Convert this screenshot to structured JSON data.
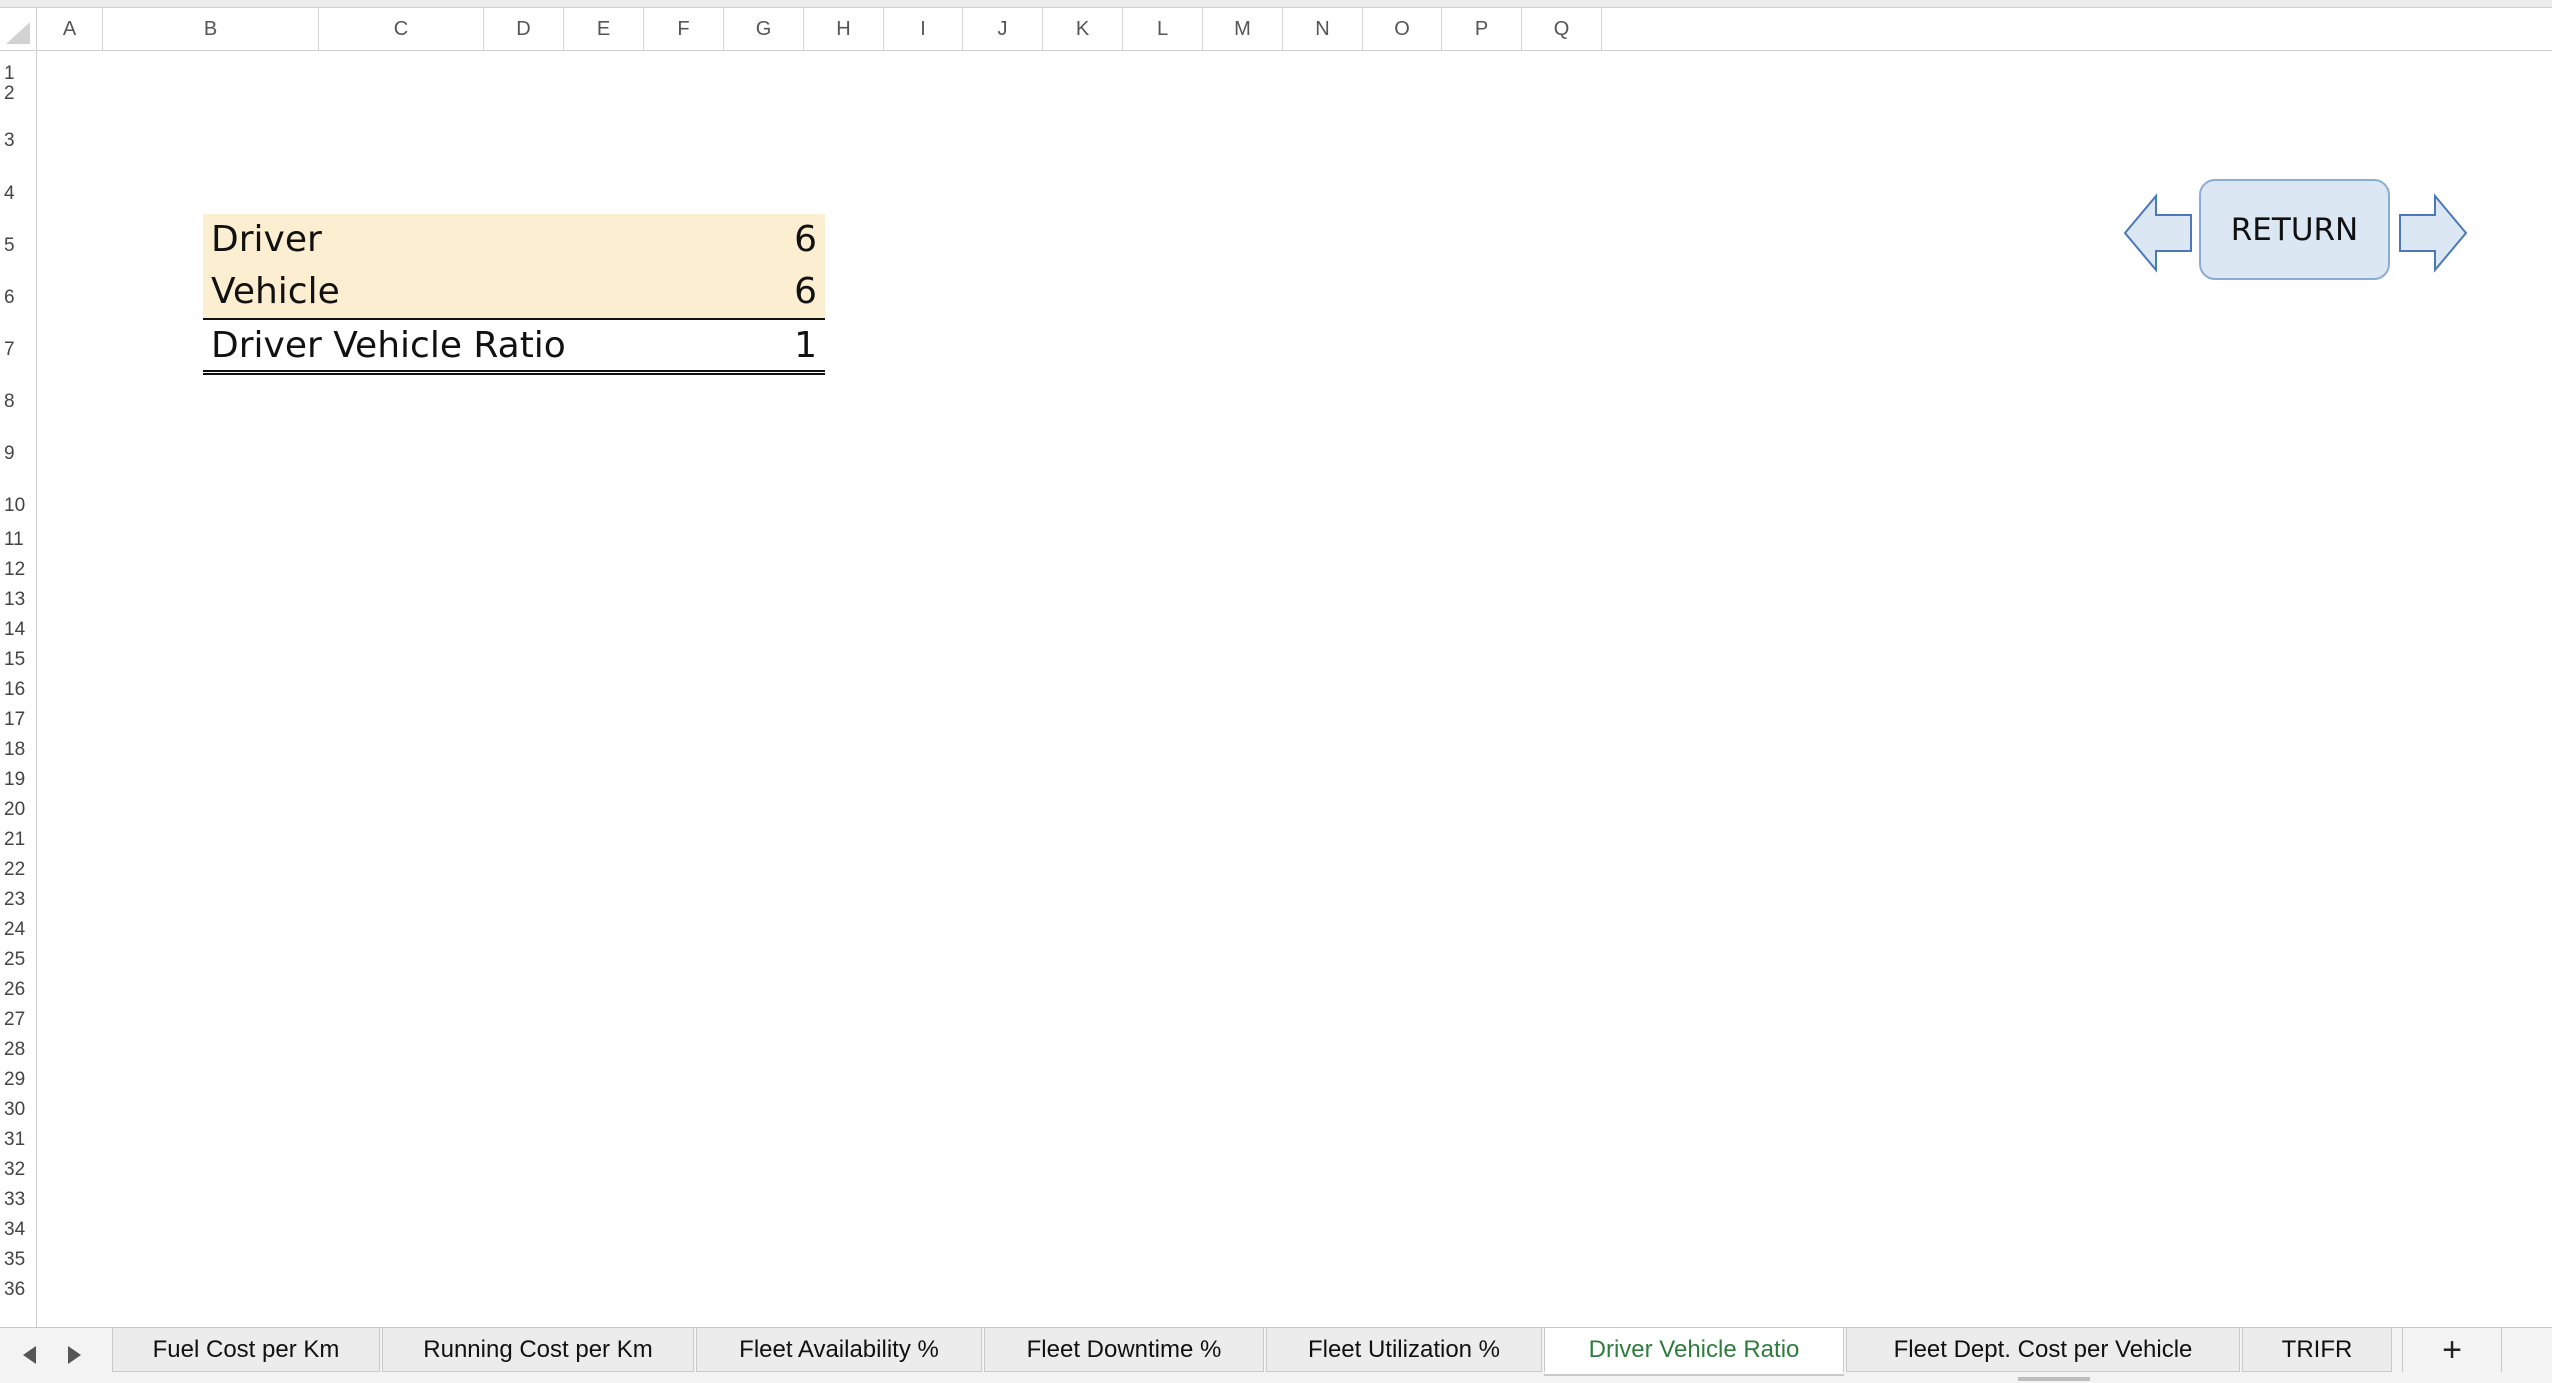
{
  "columns": [
    "A",
    "B",
    "C",
    "D",
    "E",
    "F",
    "G",
    "H",
    "I",
    "J",
    "K",
    "L",
    "M",
    "N",
    "O",
    "P",
    "Q"
  ],
  "rows": [
    "1",
    "2",
    "3",
    "4",
    "5",
    "6",
    "7",
    "8",
    "9",
    "10",
    "11",
    "12",
    "13",
    "14",
    "15",
    "16",
    "17",
    "18",
    "19",
    "20",
    "21",
    "22",
    "23",
    "24",
    "25",
    "26",
    "27",
    "28",
    "29",
    "30",
    "31",
    "32",
    "33",
    "34",
    "35",
    "36"
  ],
  "table": {
    "driver_label": "Driver",
    "driver_value": "6",
    "vehicle_label": "Vehicle",
    "vehicle_value": "6",
    "ratio_label": "Driver Vehicle Ratio",
    "ratio_value": "1"
  },
  "nav": {
    "return_label": "RETURN"
  },
  "sheet_tabs": [
    {
      "label": "Fuel Cost per Km"
    },
    {
      "label": "Running Cost per Km"
    },
    {
      "label": "Fleet Availability %"
    },
    {
      "label": "Fleet Downtime %"
    },
    {
      "label": "Fleet Utilization %"
    },
    {
      "label": "Driver Vehicle Ratio",
      "active": true
    },
    {
      "label": "Fleet Dept. Cost per Vehicle"
    },
    {
      "label": "TRIFR"
    }
  ],
  "add_sheet_label": "+",
  "colors": {
    "input_fill": "#fcefd1",
    "active_tab_text": "#2e7d3e",
    "button_fill": "#dce7f4",
    "arrow_stroke": "#4a78b8"
  },
  "icons": [
    "select-all-corner-icon",
    "arrow-left-icon",
    "arrow-right-icon",
    "tab-scroll-left-icon",
    "tab-scroll-right-icon"
  ]
}
